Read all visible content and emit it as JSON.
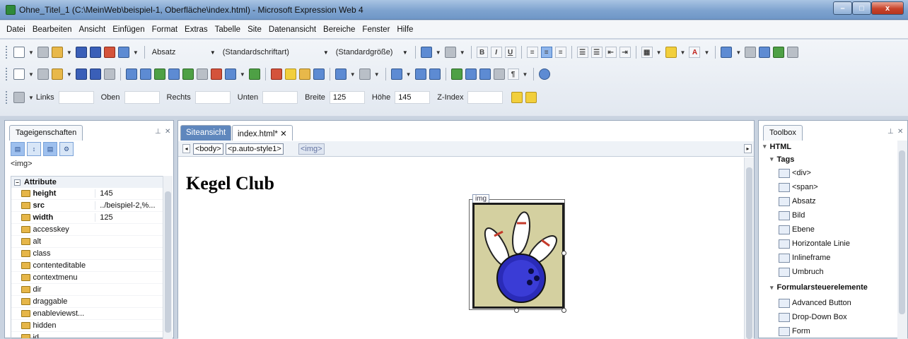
{
  "window": {
    "title": "Ohne_Titel_1 (C:\\MeinWeb\\beispiel-1, Oberfläche\\index.html) - Microsoft Expression Web 4",
    "min_label": "–",
    "max_label": "□",
    "close_label": "x"
  },
  "menu": [
    "Datei",
    "Bearbeiten",
    "Ansicht",
    "Einfügen",
    "Format",
    "Extras",
    "Tabelle",
    "Site",
    "Datenansicht",
    "Bereiche",
    "Fenster",
    "Hilfe"
  ],
  "toolbar": {
    "style_combo": "Absatz",
    "font_combo": "(Standardschriftart)",
    "size_combo": "(Standardgröße)",
    "bold": "B",
    "italic": "I",
    "underline": "U",
    "position_fields": {
      "links_label": "Links",
      "links_value": "",
      "oben_label": "Oben",
      "oben_value": "",
      "rechts_label": "Rechts",
      "rechts_value": "",
      "unten_label": "Unten",
      "unten_value": "",
      "breite_label": "Breite",
      "breite_value": "125",
      "hoehe_label": "Höhe",
      "hoehe_value": "145",
      "zindex_label": "Z-Index",
      "zindex_value": ""
    }
  },
  "tag_properties": {
    "panel_title": "Tageigenschaften",
    "current_tag": "<img>",
    "group_label": "Attribute",
    "group_toggle": "−",
    "attributes": [
      {
        "name": "height",
        "value": "145",
        "bold": true
      },
      {
        "name": "src",
        "value": "../beispiel-2,%...",
        "bold": true
      },
      {
        "name": "width",
        "value": "125",
        "bold": true
      },
      {
        "name": "accesskey",
        "value": "",
        "bold": false
      },
      {
        "name": "alt",
        "value": "",
        "bold": false
      },
      {
        "name": "class",
        "value": "",
        "bold": false
      },
      {
        "name": "contenteditable",
        "value": "",
        "bold": false
      },
      {
        "name": "contextmenu",
        "value": "",
        "bold": false
      },
      {
        "name": "dir",
        "value": "",
        "bold": false
      },
      {
        "name": "draggable",
        "value": "",
        "bold": false
      },
      {
        "name": "enableviewst...",
        "value": "",
        "bold": false
      },
      {
        "name": "hidden",
        "value": "",
        "bold": false
      },
      {
        "name": "id",
        "value": "",
        "bold": false
      }
    ]
  },
  "editor": {
    "tab_site": "Siteansicht",
    "tab_file": "index.html* ✕",
    "breadcrumb": [
      "<body>",
      "<p.auto-style1>",
      "<img>"
    ],
    "heading": "Kegel Club",
    "image_tag_label": "img"
  },
  "toolbox": {
    "panel_title": "Toolbox",
    "html_section": "HTML",
    "tags_section": "Tags",
    "tags": [
      "<div>",
      "<span>",
      "Absatz",
      "Bild",
      "Ebene",
      "Horizontale Linie",
      "Inlineframe",
      "Umbruch"
    ],
    "forms_section": "Formularsteuerelemente",
    "forms": [
      "Advanced Button",
      "Drop-Down Box",
      "Form"
    ]
  }
}
